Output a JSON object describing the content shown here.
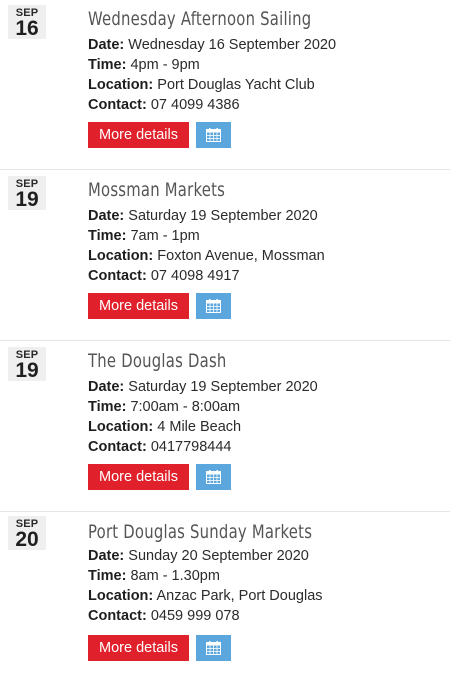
{
  "labels": {
    "date": "Date:",
    "time": "Time:",
    "location": "Location:",
    "contact": "Contact:",
    "more_details": "More details"
  },
  "colors": {
    "more_button": "#e0202a",
    "calendar_button": "#5aa6dd",
    "badge_background": "#efefef",
    "title": "#555555"
  },
  "icons": {
    "calendar_button": "calendar-icon"
  },
  "events": [
    {
      "month": "SEP",
      "day": "16",
      "title": "Wednesday Afternoon Sailing",
      "date": "Wednesday 16 September 2020",
      "time": "4pm - 9pm",
      "location": "Port Douglas Yacht Club",
      "contact": "07 4099 4386"
    },
    {
      "month": "SEP",
      "day": "19",
      "title": "Mossman Markets",
      "date": "Saturday 19 September 2020",
      "time": "7am - 1pm",
      "location": "Foxton Avenue, Mossman",
      "contact": "07 4098 4917"
    },
    {
      "month": "SEP",
      "day": "19",
      "title": "The Douglas Dash",
      "date": "Saturday 19 September 2020",
      "time": "7:00am - 8:00am",
      "location": "4 Mile Beach",
      "contact": "0417798444"
    },
    {
      "month": "SEP",
      "day": "20",
      "title": "Port Douglas Sunday Markets",
      "date": "Sunday 20 September 2020",
      "time": "8am - 1.30pm",
      "location": "Anzac Park, Port Douglas",
      "contact": "0459 999 078"
    }
  ]
}
